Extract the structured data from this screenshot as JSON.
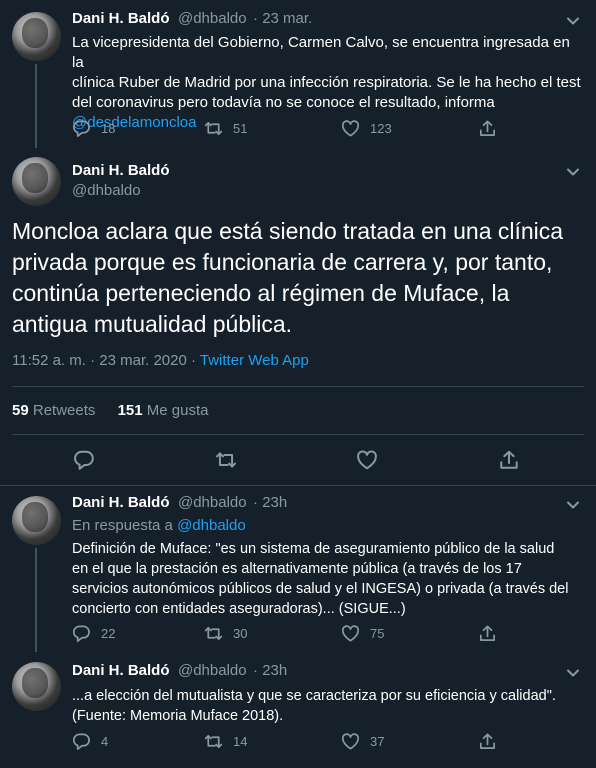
{
  "tweets": [
    {
      "name": "Dani H. Baldó",
      "handle": "@dhbaldo",
      "time": "· 23 mar.",
      "text_line1": "La vicepresidenta del Gobierno, Carmen Calvo, se encuentra ingresada en la",
      "text_line2": "clínica Ruber de Madrid por una infección respiratoria. Se le ha hecho el test",
      "text_line3": "del coronavirus pero todavía no se conoce el resultado, informa",
      "mention": "@desdelamoncloa",
      "replies": "18",
      "retweets": "51",
      "likes": "123"
    },
    {
      "name": "Dani H. Baldó",
      "handle": "@dhbaldo",
      "reply_to_label": "En respuesta a",
      "reply_to_handle": "@dhbaldo",
      "time": "· 23h",
      "text_line1": "Definición de Muface: \"es un sistema de aseguramiento público de la salud",
      "text_line2": "en el que la prestación es alternativamente pública (a través de los 17",
      "text_line3": "servicios autonómicos públicos de salud y el INGESA) o privada (a través del",
      "text_line4": "concierto con entidades aseguradoras)... (SIGUE...)",
      "replies": "22",
      "retweets": "30",
      "likes": "75"
    },
    {
      "name": "Dani H. Baldó",
      "handle": "@dhbaldo",
      "time": "· 23h",
      "text_line1": "...a elección del mutualista y que se caracteriza por su eficiencia y calidad\".",
      "text_line2": "(Fuente: Memoria Muface 2018).",
      "replies": "4",
      "retweets": "14",
      "likes": "37"
    }
  ],
  "main_tweet": {
    "name": "Dani H. Baldó",
    "handle": "@dhbaldo",
    "text_line1": "Moncloa aclara que está siendo tratada en una clínica",
    "text_line2": "privada porque es funcionaria de carrera y, por tanto,",
    "text_line3": "continúa perteneciendo al régimen de Muface, la",
    "text_line4": "antigua mutualidad pública.",
    "timestamp": "11:52 a. m. · 23 mar. 2020 ·",
    "source": "Twitter Web App",
    "retweets_count": "59",
    "retweets_label": "Retweets",
    "likes_count": "151",
    "likes_label": "Me gusta"
  },
  "icons": {
    "reply": "reply-icon",
    "retweet": "retweet-icon",
    "like": "heart-icon",
    "share": "share-icon",
    "more": "chevron-down-icon"
  },
  "colors": {
    "background": "#15202b",
    "link": "#1da1f2",
    "muted": "#8899a6",
    "divider": "#38444d"
  }
}
